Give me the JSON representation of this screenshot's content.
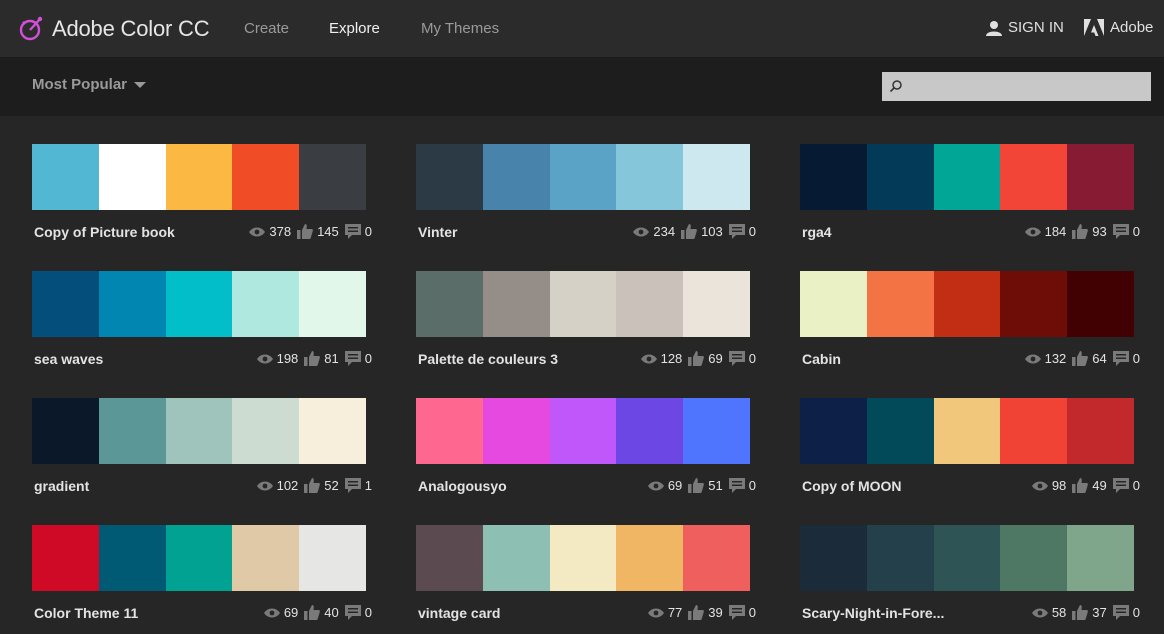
{
  "header": {
    "app_title": "Adobe Color CC",
    "nav": [
      {
        "label": "Create",
        "active": false
      },
      {
        "label": "Explore",
        "active": true
      },
      {
        "label": "My Themes",
        "active": false
      }
    ],
    "sign_in": "SIGN IN",
    "adobe": "Adobe",
    "logo_color": "#d34fd8"
  },
  "filter": {
    "dropdown_label": "Most Popular",
    "search_placeholder": "",
    "search_value": ""
  },
  "themes": [
    {
      "name": "Copy of Picture book",
      "views": "378",
      "likes": "145",
      "comments": "0",
      "colors": [
        "#51b7d3",
        "#ffffff",
        "#fbb944",
        "#f04c26",
        "#3a3e42"
      ]
    },
    {
      "name": "Vinter",
      "views": "234",
      "likes": "103",
      "comments": "0",
      "colors": [
        "#2c3a45",
        "#4883ab",
        "#5aa2c6",
        "#86c6da",
        "#cde9ef"
      ]
    },
    {
      "name": "rga4",
      "views": "184",
      "likes": "93",
      "comments": "0",
      "colors": [
        "#071a33",
        "#023a58",
        "#01a696",
        "#f24537",
        "#861b33"
      ]
    },
    {
      "name": "sea waves",
      "views": "198",
      "likes": "81",
      "comments": "0",
      "colors": [
        "#034e7b",
        "#0185b1",
        "#01bec8",
        "#aee8df",
        "#e1f7e9"
      ]
    },
    {
      "name": "Palette de couleurs 3",
      "views": "128",
      "likes": "69",
      "comments": "0",
      "colors": [
        "#5a6d69",
        "#958d88",
        "#d5d1c6",
        "#cac1bb",
        "#ebe4db"
      ]
    },
    {
      "name": "Cabin",
      "views": "132",
      "likes": "64",
      "comments": "0",
      "colors": [
        "#eaf2c5",
        "#f37345",
        "#c22e14",
        "#6e0d08",
        "#410002"
      ]
    },
    {
      "name": "gradient",
      "views": "102",
      "likes": "52",
      "comments": "1",
      "colors": [
        "#0a1829",
        "#5b9797",
        "#9ec4bc",
        "#ccdcd1",
        "#f7efdb"
      ]
    },
    {
      "name": "Analogousyo",
      "views": "69",
      "likes": "51",
      "comments": "0",
      "colors": [
        "#fe6890",
        "#e649e0",
        "#bf57fb",
        "#6d47e4",
        "#4f74fe"
      ]
    },
    {
      "name": "Copy of MOON",
      "views": "98",
      "likes": "49",
      "comments": "0",
      "colors": [
        "#0c2048",
        "#024a5a",
        "#f0c77b",
        "#f04336",
        "#c2292d"
      ]
    },
    {
      "name": "Color Theme 11",
      "views": "69",
      "likes": "40",
      "comments": "0",
      "colors": [
        "#cf0a27",
        "#005a73",
        "#01a291",
        "#e0c9a7",
        "#e6e7e5"
      ]
    },
    {
      "name": "vintage card",
      "views": "77",
      "likes": "39",
      "comments": "0",
      "colors": [
        "#5b4a50",
        "#8ebfb3",
        "#f3e9c3",
        "#f1b664",
        "#ef5f5e"
      ]
    },
    {
      "name": "Scary-Night-in-Fore...",
      "views": "58",
      "likes": "37",
      "comments": "0",
      "colors": [
        "#1b2b3a",
        "#24414b",
        "#2e5456",
        "#4e7764",
        "#7fa58a"
      ]
    }
  ]
}
